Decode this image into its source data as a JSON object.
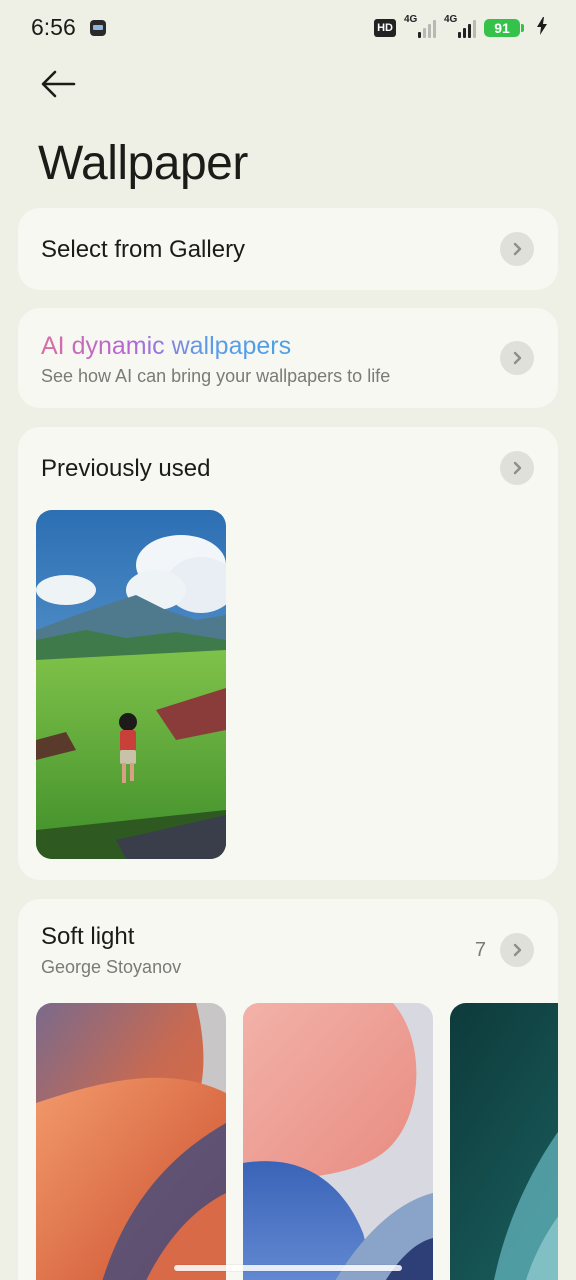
{
  "status_bar": {
    "time": "6:56",
    "hd_label": "HD",
    "network_1": "4G",
    "network_2": "4G",
    "battery": "91"
  },
  "header": {
    "back_icon": "arrow-left-icon",
    "title": "Wallpaper"
  },
  "gallery": {
    "label": "Select from Gallery"
  },
  "ai_wallpapers": {
    "title": "AI dynamic wallpapers",
    "subtitle": "See how AI can bring your wallpapers to life"
  },
  "previously_used": {
    "title": "Previously used"
  },
  "soft_light": {
    "title": "Soft light",
    "author": "George Stoyanov",
    "count": "7"
  },
  "colors": {
    "background": "#eef0e6",
    "card": "#f7f8f2",
    "battery": "#35c24a",
    "ai_gradient_start": "#d76fa3",
    "ai_gradient_end": "#4aa0e6"
  }
}
